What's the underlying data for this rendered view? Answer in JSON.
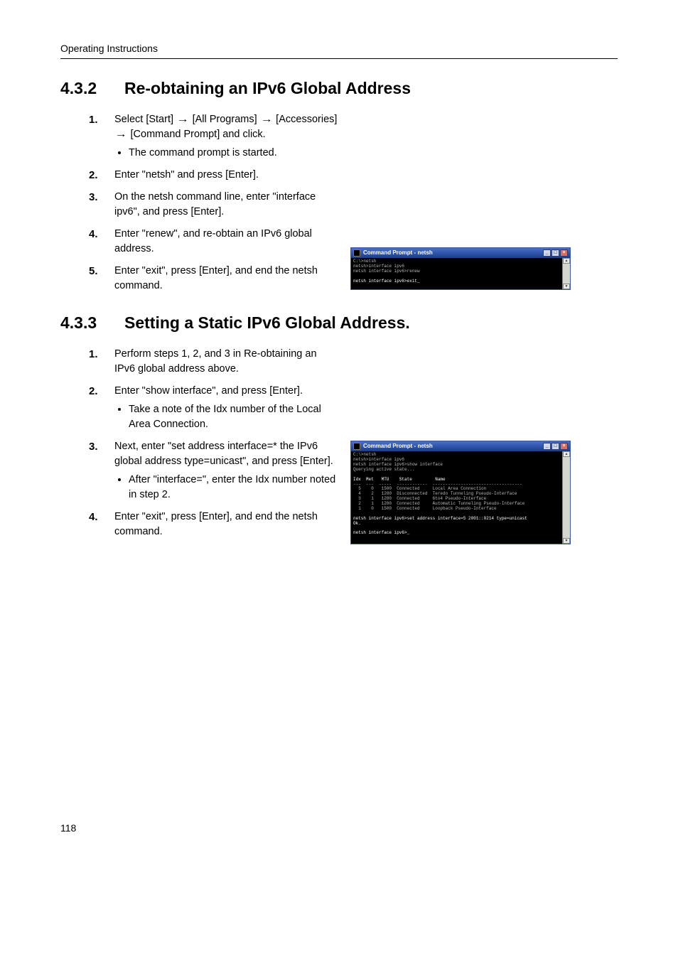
{
  "header": "Operating Instructions",
  "page_number": "118",
  "sections": [
    {
      "number": "4.3.2",
      "title": "Re-obtaining an IPv6 Global Address"
    },
    {
      "number": "4.3.3",
      "title": "Setting a Static IPv6 Global Address."
    }
  ],
  "s432": {
    "steps": [
      {
        "n": "1.",
        "text_parts": [
          "Select [Start] ",
          " [All Programs] ",
          " [Accessories] ",
          " [Command Prompt] and click."
        ],
        "sub": [
          "The command prompt is started."
        ]
      },
      {
        "n": "2.",
        "text": "Enter \"netsh\" and press [Enter]."
      },
      {
        "n": "3.",
        "text": "On the netsh command line, enter \"interface ipv6\", and press [Enter]."
      },
      {
        "n": "4.",
        "text": "Enter \"renew\", and re-obtain an IPv6 global address."
      },
      {
        "n": "5.",
        "text": "Enter \"exit\", press [Enter], and end the netsh command."
      }
    ]
  },
  "s433": {
    "steps": [
      {
        "n": "1.",
        "text": "Perform steps 1, 2, and 3 in Re-obtaining an IPv6 global address above."
      },
      {
        "n": "2.",
        "text": "Enter \"show interface\", and press [Enter].",
        "sub": [
          "Take a note of the Idx number of the Local Area Connection."
        ]
      },
      {
        "n": "3.",
        "text": "Next, enter \"set address interface=* the IPv6 global address type=unicast\", and press [Enter].",
        "sub": [
          "After \"interface=\", enter the Idx number noted in step 2."
        ]
      },
      {
        "n": "4.",
        "text": "Enter \"exit\", press [Enter], and end the netsh command."
      }
    ]
  },
  "cmd1": {
    "title": "Command Prompt - netsh",
    "lines": [
      "C:\\>netsh",
      "netsh>interface ipv6",
      "netsh interface ipv6>renew",
      "",
      "netsh interface ipv6>exit_"
    ]
  },
  "cmd2": {
    "title": "Command Prompt - netsh",
    "lines_pre": [
      "C:\\>netsh",
      "netsh>interface ipv6",
      "netsh interface ipv6>show interface",
      "Querying active state...",
      ""
    ],
    "table_header": "Idx  Met   MTU    State         Name",
    "table_divider": "---  ---  -----  ------------  -----------------------------------",
    "table_rows": [
      "  5    0   1500  Connected     Local Area Connection",
      "  4    2   1280  Disconnected  Teredo Tunneling Pseudo-Interface",
      "  3    1   1280  Connected     6to4 Pseudo-Interface",
      "  2    1   1280  Connected     Automatic Tunneling Pseudo-Interface",
      "  1    0   1500  Connected     Loopback Pseudo-Interface"
    ],
    "lines_post": [
      "",
      "netsh interface ipv6>set address interface=5 2001::0214 type=unicast",
      "Ok.",
      "",
      "netsh interface ipv6>_"
    ]
  }
}
